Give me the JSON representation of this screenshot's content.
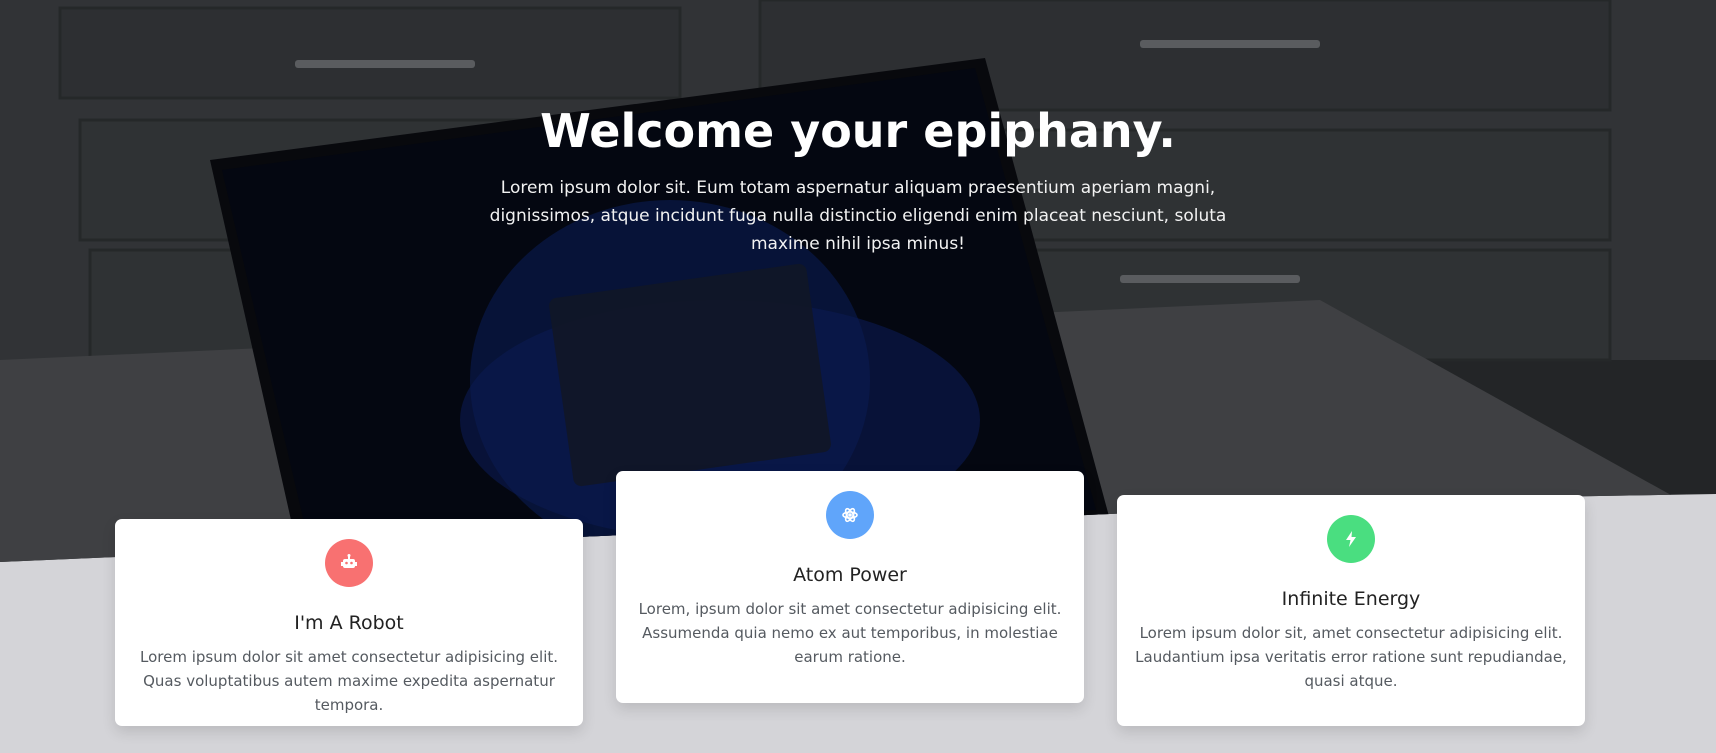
{
  "hero": {
    "title": "Welcome your epiphany.",
    "subtitle": "Lorem ipsum dolor sit. Eum totam aspernatur aliquam praesentium aperiam magni, dignissimos, atque incidunt fuga nulla distinctio eligendi enim placeat nesciunt, soluta maxime nihil ipsa minus!"
  },
  "cards": [
    {
      "icon": "robot-icon",
      "color": "#f87171",
      "title": "I'm A Robot",
      "text": "Lorem ipsum dolor sit amet consectetur adipisicing elit. Quas voluptatibus autem maxime expedita aspernatur tempora."
    },
    {
      "icon": "atom-icon",
      "color": "#60a5fa",
      "title": "Atom Power",
      "text": "Lorem, ipsum dolor sit amet consectetur adipisicing elit. Assumenda quia nemo ex aut temporibus, in molestiae earum ratione."
    },
    {
      "icon": "bolt-icon",
      "color": "#4ade80",
      "title": "Infinite Energy",
      "text": "Lorem ipsum dolor sit, amet consectetur adipisicing elit. Laudantium ipsa veritatis error ratione sunt repudiandae, quasi atque."
    }
  ]
}
